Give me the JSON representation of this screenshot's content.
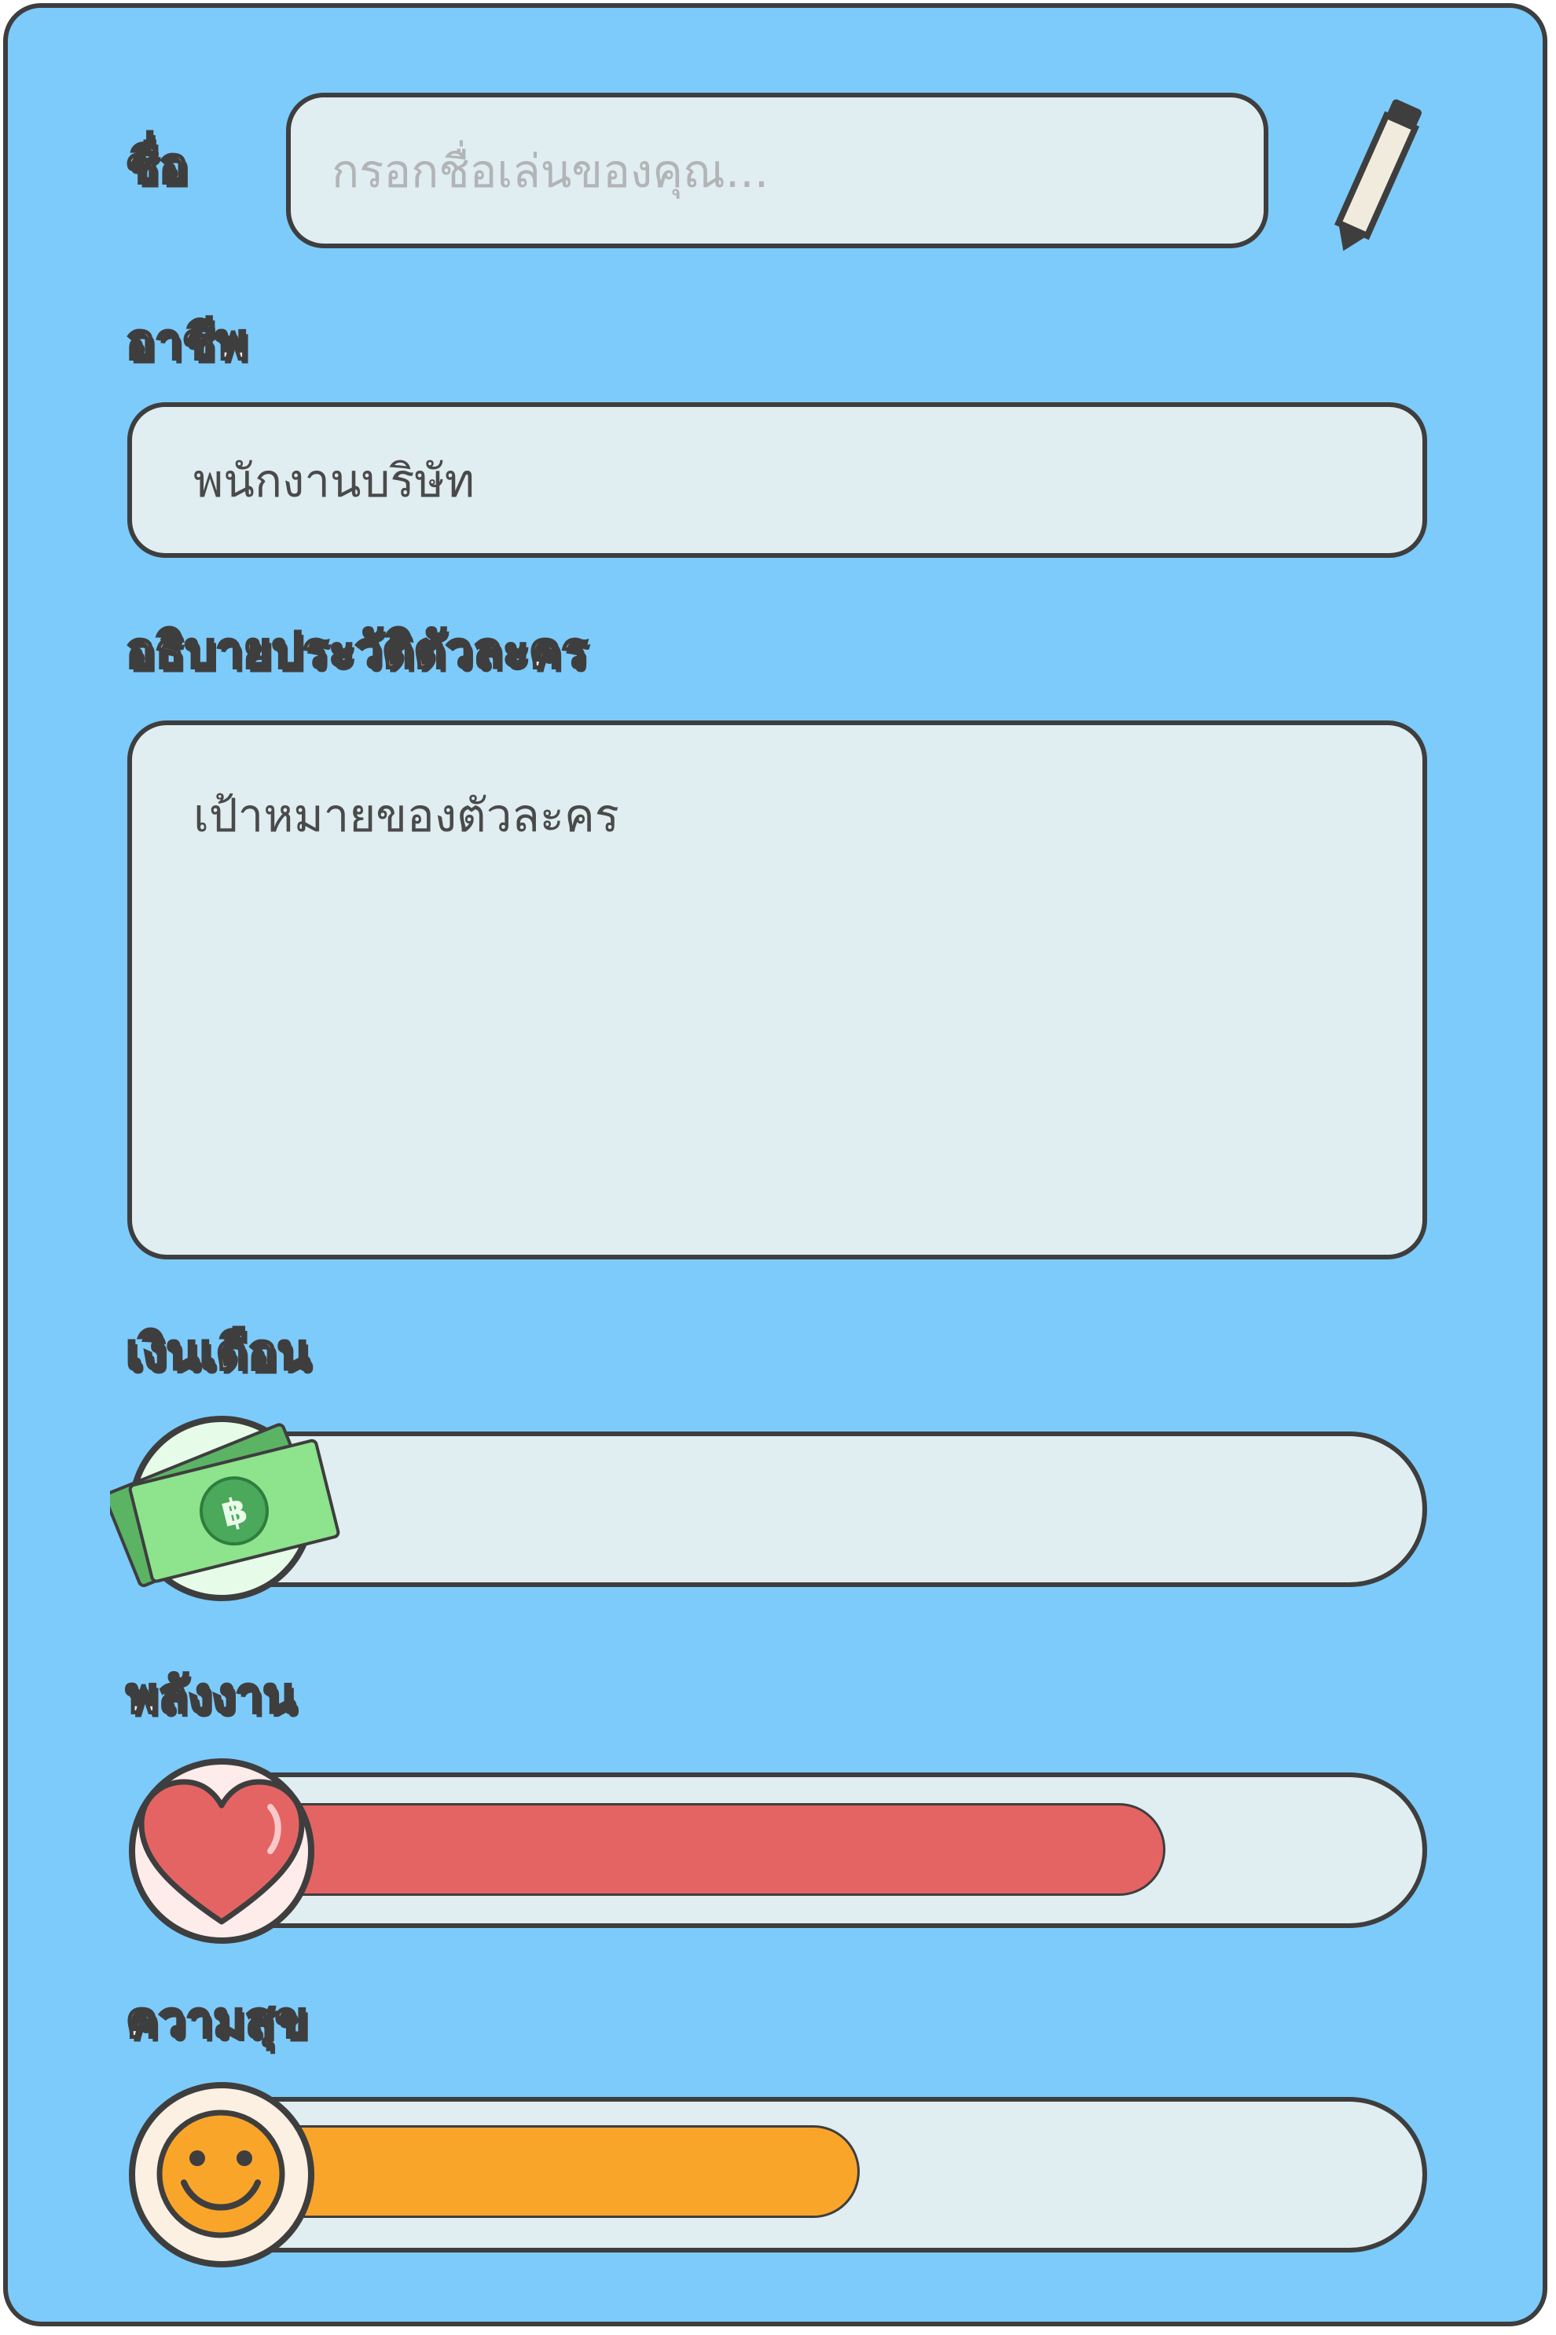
{
  "form": {
    "name": {
      "label": "ชื่อ",
      "placeholder": "กรอกชื่อเล่นของคุณ...",
      "value": "",
      "icon": "pencil-icon"
    },
    "occupation": {
      "label": "อาชีพ",
      "value": "พนักงานบริษัท"
    },
    "description": {
      "label": "อธิบายประวัติตัวละคร",
      "value": "เป้าหมายของตัวละคร"
    }
  },
  "stats": {
    "salary": {
      "label": "เงินเดือน",
      "icon": "money-icon",
      "fill_fraction": 0.0,
      "color": "#8fe08f"
    },
    "energy": {
      "label": "พลังงาน",
      "icon": "heart-icon",
      "fill_fraction": 0.78,
      "color": "#e46464"
    },
    "happiness": {
      "label": "ความสุข",
      "icon": "smiley-icon",
      "fill_fraction": 0.51,
      "color": "#f9a52a"
    }
  },
  "colors": {
    "background": "#7ccbfb",
    "field": "#e0edf1",
    "outline": "#3e3e3e",
    "label_text": "#f4ecdf"
  }
}
